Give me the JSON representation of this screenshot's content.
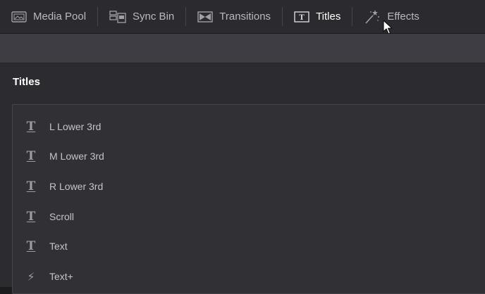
{
  "toolbar": {
    "tabs": [
      {
        "label": "Media Pool",
        "icon": "media-pool-icon"
      },
      {
        "label": "Sync Bin",
        "icon": "sync-bin-icon"
      },
      {
        "label": "Transitions",
        "icon": "transitions-icon"
      },
      {
        "label": "Titles",
        "icon": "titles-icon",
        "active": true
      },
      {
        "label": "Effects",
        "icon": "effects-icon"
      }
    ]
  },
  "panel": {
    "title": "Titles",
    "items": [
      {
        "label": "L Lower 3rd",
        "icon": "title-t-icon"
      },
      {
        "label": "M Lower 3rd",
        "icon": "title-t-icon"
      },
      {
        "label": "R Lower 3rd",
        "icon": "title-t-icon"
      },
      {
        "label": "Scroll",
        "icon": "title-t-icon"
      },
      {
        "label": "Text",
        "icon": "title-t-icon"
      },
      {
        "label": "Text+",
        "icon": "fusion-bolt-icon"
      }
    ]
  },
  "colors": {
    "toolbar_bg": "#2b2b2f",
    "subbar_bg": "#3d3d43",
    "panel_bg": "#2c2c30",
    "active_text": "#ffffff"
  }
}
